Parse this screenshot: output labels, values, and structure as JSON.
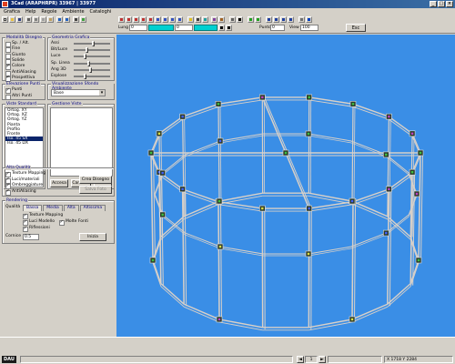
{
  "window": {
    "title": "3Cad (ARAPHRPR) 33967 | 33977"
  },
  "menu": [
    "Grafica",
    "Help",
    "Regole",
    "Ambiente",
    "Cataloghi"
  ],
  "toolbar": {
    "field_lung_label": "Lung",
    "field_lung_value": "0",
    "field_alt_value": "0",
    "field_punto_label": "Punto",
    "field_punto_value": "0",
    "field_view_label": "View",
    "field_view_value": "100",
    "esc_label": "Esc"
  },
  "left": {
    "modalita": {
      "title": "Modalità Disegno",
      "items": [
        {
          "label": "Sp. / Alt.",
          "on": false
        },
        {
          "label": "Fine",
          "on": false
        },
        {
          "label": "Giunto",
          "on": false
        },
        {
          "label": "Solide",
          "on": false
        },
        {
          "label": "Colore",
          "on": true
        },
        {
          "label": "AntiAliasing",
          "on": false
        },
        {
          "label": "Prospettiva",
          "on": true
        }
      ]
    },
    "geometria": {
      "title": "Geometria Grafica",
      "sliders": [
        {
          "label": "Assi",
          "value": 0.55
        },
        {
          "label": "Bit/Luce",
          "value": 0.35
        },
        {
          "label": "Luce",
          "value": 0.3
        },
        {
          "label": "Sp. Linea",
          "value": 0.4
        },
        {
          "label": "Ang 3D",
          "value": 0.45
        },
        {
          "label": "Esplose",
          "value": 0.3
        }
      ]
    },
    "elevazione": {
      "title": "Elevazione Punti",
      "items": [
        {
          "label": "Punti",
          "on": true
        },
        {
          "label": "Altri Punti",
          "on": false
        }
      ]
    },
    "visualizzazione": {
      "title": "Visualizzazione Sfondo Ambiente",
      "select_value": "Base"
    },
    "viste": {
      "title": "Viste Standard",
      "items": [
        "Ortog. XY",
        "Ortog. XZ",
        "Ortog. YZ",
        "Pianta",
        "Profilo",
        "Fronte",
        "Iso. 45 SX",
        "Iso. 45 DX"
      ],
      "selected": 6
    },
    "gestione": {
      "title": "Gestione Viste"
    },
    "buttons": {
      "accesa": "Accesa",
      "cancella": "Cancella",
      "salva": "Salva"
    },
    "alta_qualita": {
      "title": "Alta Qualità",
      "items": [
        {
          "label": "Texture Mapping",
          "on": true
        },
        {
          "label": "Luci/materiali",
          "on": true
        },
        {
          "label": "Ombreggiature",
          "on": true
        },
        {
          "label": "AntiAliasing",
          "on": true
        }
      ],
      "crea_label": "Crea Disegno",
      "salva_label": "Salva Foto"
    },
    "rendering": {
      "title": "Rendering",
      "qualita_label": "Qualità",
      "tabs": [
        "Bassa",
        "Media",
        "Alta",
        "Altissima"
      ],
      "active_tab": 0,
      "items": [
        {
          "label": "Texture Mapping",
          "on": true
        },
        {
          "label": "Luci Modello",
          "on": true
        },
        {
          "label": "Molte Fonti",
          "on": true
        },
        {
          "label": "Riflessioni",
          "on": true
        }
      ],
      "cornice_label": "Cornice",
      "cornice_value": "0.5",
      "init_label": "Inizia"
    }
  },
  "statusbar": {
    "logo": "DAU",
    "page": "1",
    "coords": "X 1718 Y 2284",
    "left_arrow": "◄",
    "right_arrow": "►"
  },
  "colors": {
    "viewport_bg": "#3a8ee6",
    "truss": "#d8d0c8",
    "title_bar": "#0a246a"
  }
}
